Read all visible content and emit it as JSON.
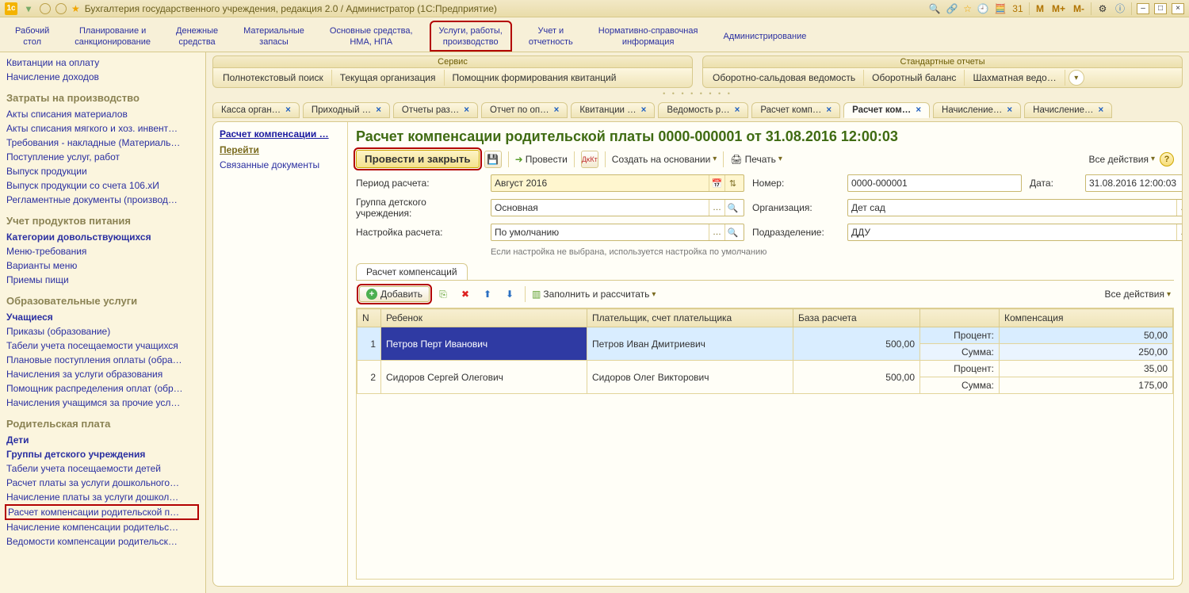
{
  "titlebar": {
    "logo": "1с",
    "title": "Бухгалтерия государственного учреждения, редакция 2.0 / Администратор  (1С:Предприятие)",
    "m_labels": [
      "M",
      "M+",
      "M-"
    ]
  },
  "sections": [
    {
      "l1": "Рабочий",
      "l2": "стол"
    },
    {
      "l1": "Планирование и",
      "l2": "санкционирование"
    },
    {
      "l1": "Денежные",
      "l2": "средства"
    },
    {
      "l1": "Материальные",
      "l2": "запасы"
    },
    {
      "l1": "Основные средства,",
      "l2": "НМА, НПА"
    },
    {
      "l1": "Услуги, работы,",
      "l2": "производство",
      "highlight": true
    },
    {
      "l1": "Учет и",
      "l2": "отчетность"
    },
    {
      "l1": "Нормативно-справочная",
      "l2": "информация"
    },
    {
      "l1": "Администрирование",
      "l2": ""
    }
  ],
  "sidebar": {
    "top": [
      "Квитанции на оплату",
      "Начисление доходов"
    ],
    "groups": [
      {
        "title": "Затраты на производство",
        "items": [
          "Акты списания материалов",
          "Акты списания мягкого и хоз. инвент…",
          "Требования - накладные (Материаль…",
          "Поступление услуг, работ",
          "Выпуск продукции",
          "Выпуск продукции со счета 106.хИ",
          "Регламентные документы (производ…"
        ]
      },
      {
        "title": "Учет продуктов питания",
        "items": [
          {
            "t": "Категории довольствующихся",
            "bold": true
          },
          "Меню-требования",
          "Варианты меню",
          "Приемы пищи"
        ]
      },
      {
        "title": "Образовательные услуги",
        "items": [
          {
            "t": "Учащиеся",
            "bold": true
          },
          "Приказы (образование)",
          "Табели учета посещаемости учащихся",
          "Плановые поступления оплаты (обра…",
          "Начисления за услуги образования",
          "Помощник распределения оплат (обр…",
          "Начисления учащимся за прочие усл…"
        ]
      },
      {
        "title": "Родительская плата",
        "items": [
          {
            "t": "Дети",
            "bold": true
          },
          {
            "t": "Группы детского учреждения",
            "bold": true
          },
          "Табели учета посещаемости детей",
          "Расчет платы за услуги дошкольного…",
          "Начисление платы за услуги дошкол…",
          {
            "t": "Расчет компенсации родительской п…",
            "highlight": true
          },
          "Начисление компенсации родительс…",
          "Ведомости компенсации родительск…"
        ]
      }
    ]
  },
  "cmd_panels": {
    "service": {
      "title": "Сервис",
      "items": [
        "Полнотекстовый поиск",
        "Текущая организация",
        "Помощник формирования квитанций"
      ]
    },
    "reports": {
      "title": "Стандартные отчеты",
      "items": [
        "Оборотно-сальдовая ведомость",
        "Оборотный баланс",
        "Шахматная ведо…"
      ]
    }
  },
  "doc_tabs": [
    "Касса орган…",
    "Приходный …",
    "Отчеты раз…",
    "Отчет по оп…",
    "Квитанции …",
    "Ведомость р…",
    "Расчет комп…",
    {
      "t": "Расчет ком…",
      "active": true
    },
    "Начисление…",
    "Начисление…"
  ],
  "ws_side": {
    "current": "Расчет компенсации …",
    "heading": "Перейти",
    "links": [
      "Связанные документы"
    ]
  },
  "doc": {
    "title": "Расчет компенсации родительской платы 0000-000001 от 31.08.2016 12:00:03",
    "toolbar": {
      "post_close": "Провести и закрыть",
      "post": "Провести",
      "create_based": "Создать на основании",
      "print": "Печать",
      "all_actions": "Все действия"
    },
    "fields": {
      "period_label": "Период расчета:",
      "period_value": "Август 2016",
      "number_label": "Номер:",
      "number_value": "0000-000001",
      "date_label": "Дата:",
      "date_value": "31.08.2016 12:00:03",
      "group_label": "Группа детского учреждения:",
      "group_value": "Основная",
      "org_label": "Организация:",
      "org_value": "Дет сад",
      "setting_label": "Настройка расчета:",
      "setting_value": "По умолчанию",
      "dept_label": "Подразделение:",
      "dept_value": "ДДУ",
      "hint": "Если настройка не выбрана, используется настройка по умолчанию"
    },
    "tab_name": "Расчет компенсаций",
    "grid_toolbar": {
      "add": "Добавить",
      "fill": "Заполнить и рассчитать",
      "all_actions": "Все действия"
    },
    "grid": {
      "col_n": "N",
      "col_child": "Ребенок",
      "col_payer": "Плательщик, счет плательщика",
      "col_base": "База расчета",
      "col_comp": "Компенсация",
      "sub_percent": "Процент:",
      "sub_sum": "Сумма:",
      "rows": [
        {
          "n": "1",
          "child": "Петров Перт Иванович",
          "payer": "Петров Иван Дмитриевич",
          "base": "500,00",
          "percent": "50,00",
          "sum": "250,00",
          "selected": true
        },
        {
          "n": "2",
          "child": "Сидоров Сергей Олегович",
          "payer": "Сидоров Олег Викторович",
          "base": "500,00",
          "percent": "35,00",
          "sum": "175,00"
        }
      ]
    }
  }
}
